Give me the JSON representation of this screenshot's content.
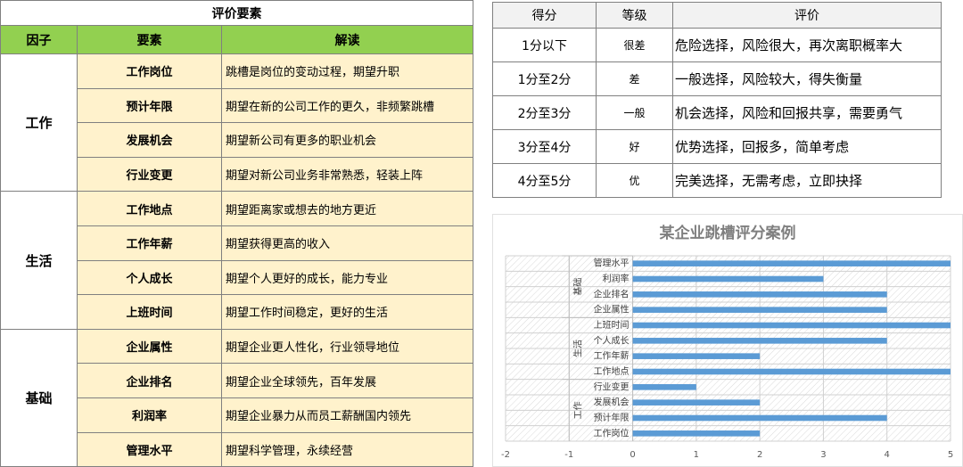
{
  "left_table": {
    "title": "评价要素",
    "headers": [
      "因子",
      "要素",
      "解读"
    ],
    "groups": [
      {
        "factor": "工作",
        "rows": [
          {
            "element": "工作岗位",
            "explain": "跳槽是岗位的变动过程，期望升职"
          },
          {
            "element": "预计年限",
            "explain": "期望在新的公司工作的更久，非频繁跳槽"
          },
          {
            "element": "发展机会",
            "explain": "期望新公司有更多的职业机会"
          },
          {
            "element": "行业变更",
            "explain": "期望对新公司业务非常熟悉，轻装上阵"
          }
        ]
      },
      {
        "factor": "生活",
        "rows": [
          {
            "element": "工作地点",
            "explain": "期望距离家或想去的地方更近"
          },
          {
            "element": "工作年薪",
            "explain": "期望获得更高的收入"
          },
          {
            "element": "个人成长",
            "explain": "期望个人更好的成长，能力专业"
          },
          {
            "element": "上班时间",
            "explain": "期望工作时间稳定，更好的生活"
          }
        ]
      },
      {
        "factor": "基础",
        "rows": [
          {
            "element": "企业属性",
            "explain": "期望企业更人性化，行业领导地位"
          },
          {
            "element": "企业排名",
            "explain": "期望企业全球领先，百年发展"
          },
          {
            "element": "利润率",
            "explain": "期望企业暴力从而员工薪酬国内领先"
          },
          {
            "element": "管理水平",
            "explain": "期望科学管理，永续经营"
          }
        ]
      }
    ]
  },
  "score_table": {
    "headers": [
      "得分",
      "等级",
      "评价"
    ],
    "rows": [
      {
        "score": "1分以下",
        "grade": "很差",
        "evaluation": "危险选择，风险很大，再次离职概率大"
      },
      {
        "score": "1分至2分",
        "grade": "差",
        "evaluation": "一般选择，风险较大，得失衡量"
      },
      {
        "score": "2分至3分",
        "grade": "一般",
        "evaluation": "机会选择，风险和回报共享，需要勇气"
      },
      {
        "score": "3分至4分",
        "grade": "好",
        "evaluation": "优势选择，回报多，简单考虑"
      },
      {
        "score": "4分至5分",
        "grade": "优",
        "evaluation": "完美选择，无需考虑，立即抉择"
      }
    ]
  },
  "chart_data": {
    "type": "bar",
    "orientation": "horizontal",
    "title": "某企业跳槽评分案例",
    "categories": [
      "工作岗位",
      "预计年限",
      "发展机会",
      "行业变更",
      "工作地点",
      "工作年薪",
      "个人成长",
      "上班时间",
      "企业属性",
      "企业排名",
      "利润率",
      "管理水平"
    ],
    "groups": [
      {
        "name": "工作",
        "categories": [
          "工作岗位",
          "预计年限",
          "发展机会",
          "行业变更"
        ]
      },
      {
        "name": "生活",
        "categories": [
          "工作地点",
          "工作年薪",
          "个人成长",
          "上班时间"
        ]
      },
      {
        "name": "基础",
        "categories": [
          "企业属性",
          "企业排名",
          "利润率",
          "管理水平"
        ]
      }
    ],
    "values": [
      2,
      4,
      2,
      1,
      5,
      2,
      4,
      5,
      4,
      4,
      3,
      5
    ],
    "xlim": [
      -2,
      5
    ],
    "xticks": [
      -2,
      -1,
      0,
      1,
      2,
      3,
      4,
      5
    ],
    "bar_color": "#5b9bd5",
    "grid": true,
    "legend": "none"
  }
}
